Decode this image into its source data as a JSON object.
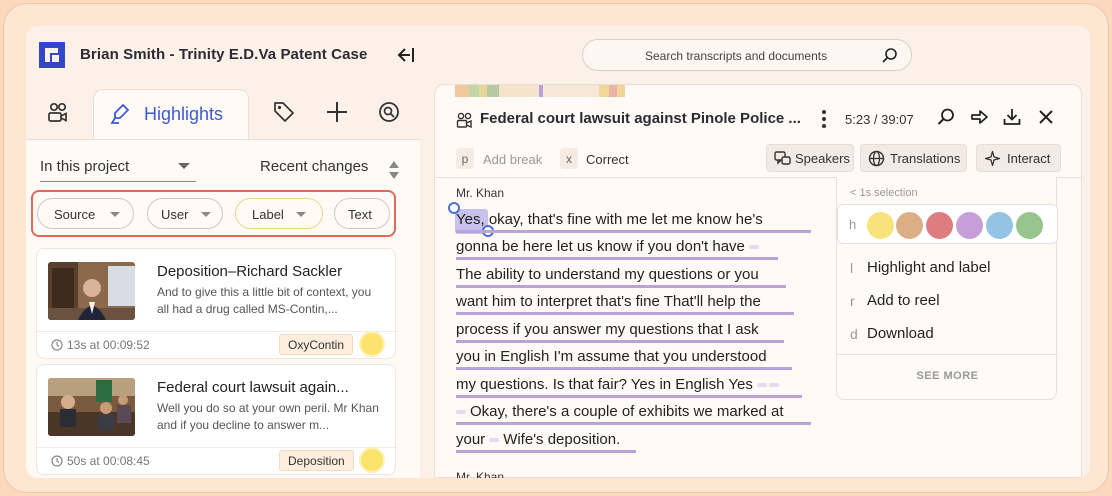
{
  "header": {
    "case_title": "Brian Smith - Trinity E.D.Va Patent Case",
    "search_placeholder": "Search transcripts and documents"
  },
  "left_panel": {
    "active_tab": "Highlights",
    "scope": "In this project",
    "sort": "Recent changes",
    "filters": [
      "Source",
      "User",
      "Label",
      "Text"
    ],
    "cards": [
      {
        "title": "Deposition–Richard Sackler",
        "excerpt": "And to give this a little bit of context, you all had a drug called MS-Contin,...",
        "time": "13s at 00:09:52",
        "tag": "OxyContin"
      },
      {
        "title": "Federal court lawsuit again...",
        "excerpt": "Well you do so at your own peril. Mr Khan and if you decline to answer m...",
        "time": "50s at 00:08:45",
        "tag": "Deposition"
      }
    ]
  },
  "transcript": {
    "title": "Federal court lawsuit against Pinole Police ...",
    "time": "5:23 / 39:07",
    "toolbar": {
      "add_break_key": "p",
      "add_break": "Add break",
      "correct_key": "x",
      "correct": "Correct",
      "speakers": "Speakers",
      "translations": "Translations",
      "interact": "Interact"
    },
    "speaker": "Mr. Khan",
    "speaker_next": "Mr. Khan",
    "selected_word": "Yes",
    "first_line_rest": ", okay, that's fine with me let me know he's",
    "lines": [
      "gonna be here let us know if you don't have",
      "The ability to understand my questions or you",
      "want him to interpret that's fine That'll help the",
      "process if you answer my questions that I ask",
      "you in English I'm assume that you understood",
      "my questions. Is that fair? Yes in English Yes",
      "Okay, there's a couple of exhibits we marked at",
      "your",
      "Wife's deposition."
    ]
  },
  "selection_menu": {
    "subtitle": "< 1s selection",
    "color_key": "h",
    "colors": [
      "#f7e27b",
      "#dcae86",
      "#dd7d7f",
      "#c69fd8",
      "#95c3e4",
      "#98c48d"
    ],
    "items": [
      {
        "key": "l",
        "label": "Highlight and label"
      },
      {
        "key": "r",
        "label": "Add to reel"
      },
      {
        "key": "d",
        "label": "Download"
      }
    ],
    "see_more": "SEE MORE"
  }
}
